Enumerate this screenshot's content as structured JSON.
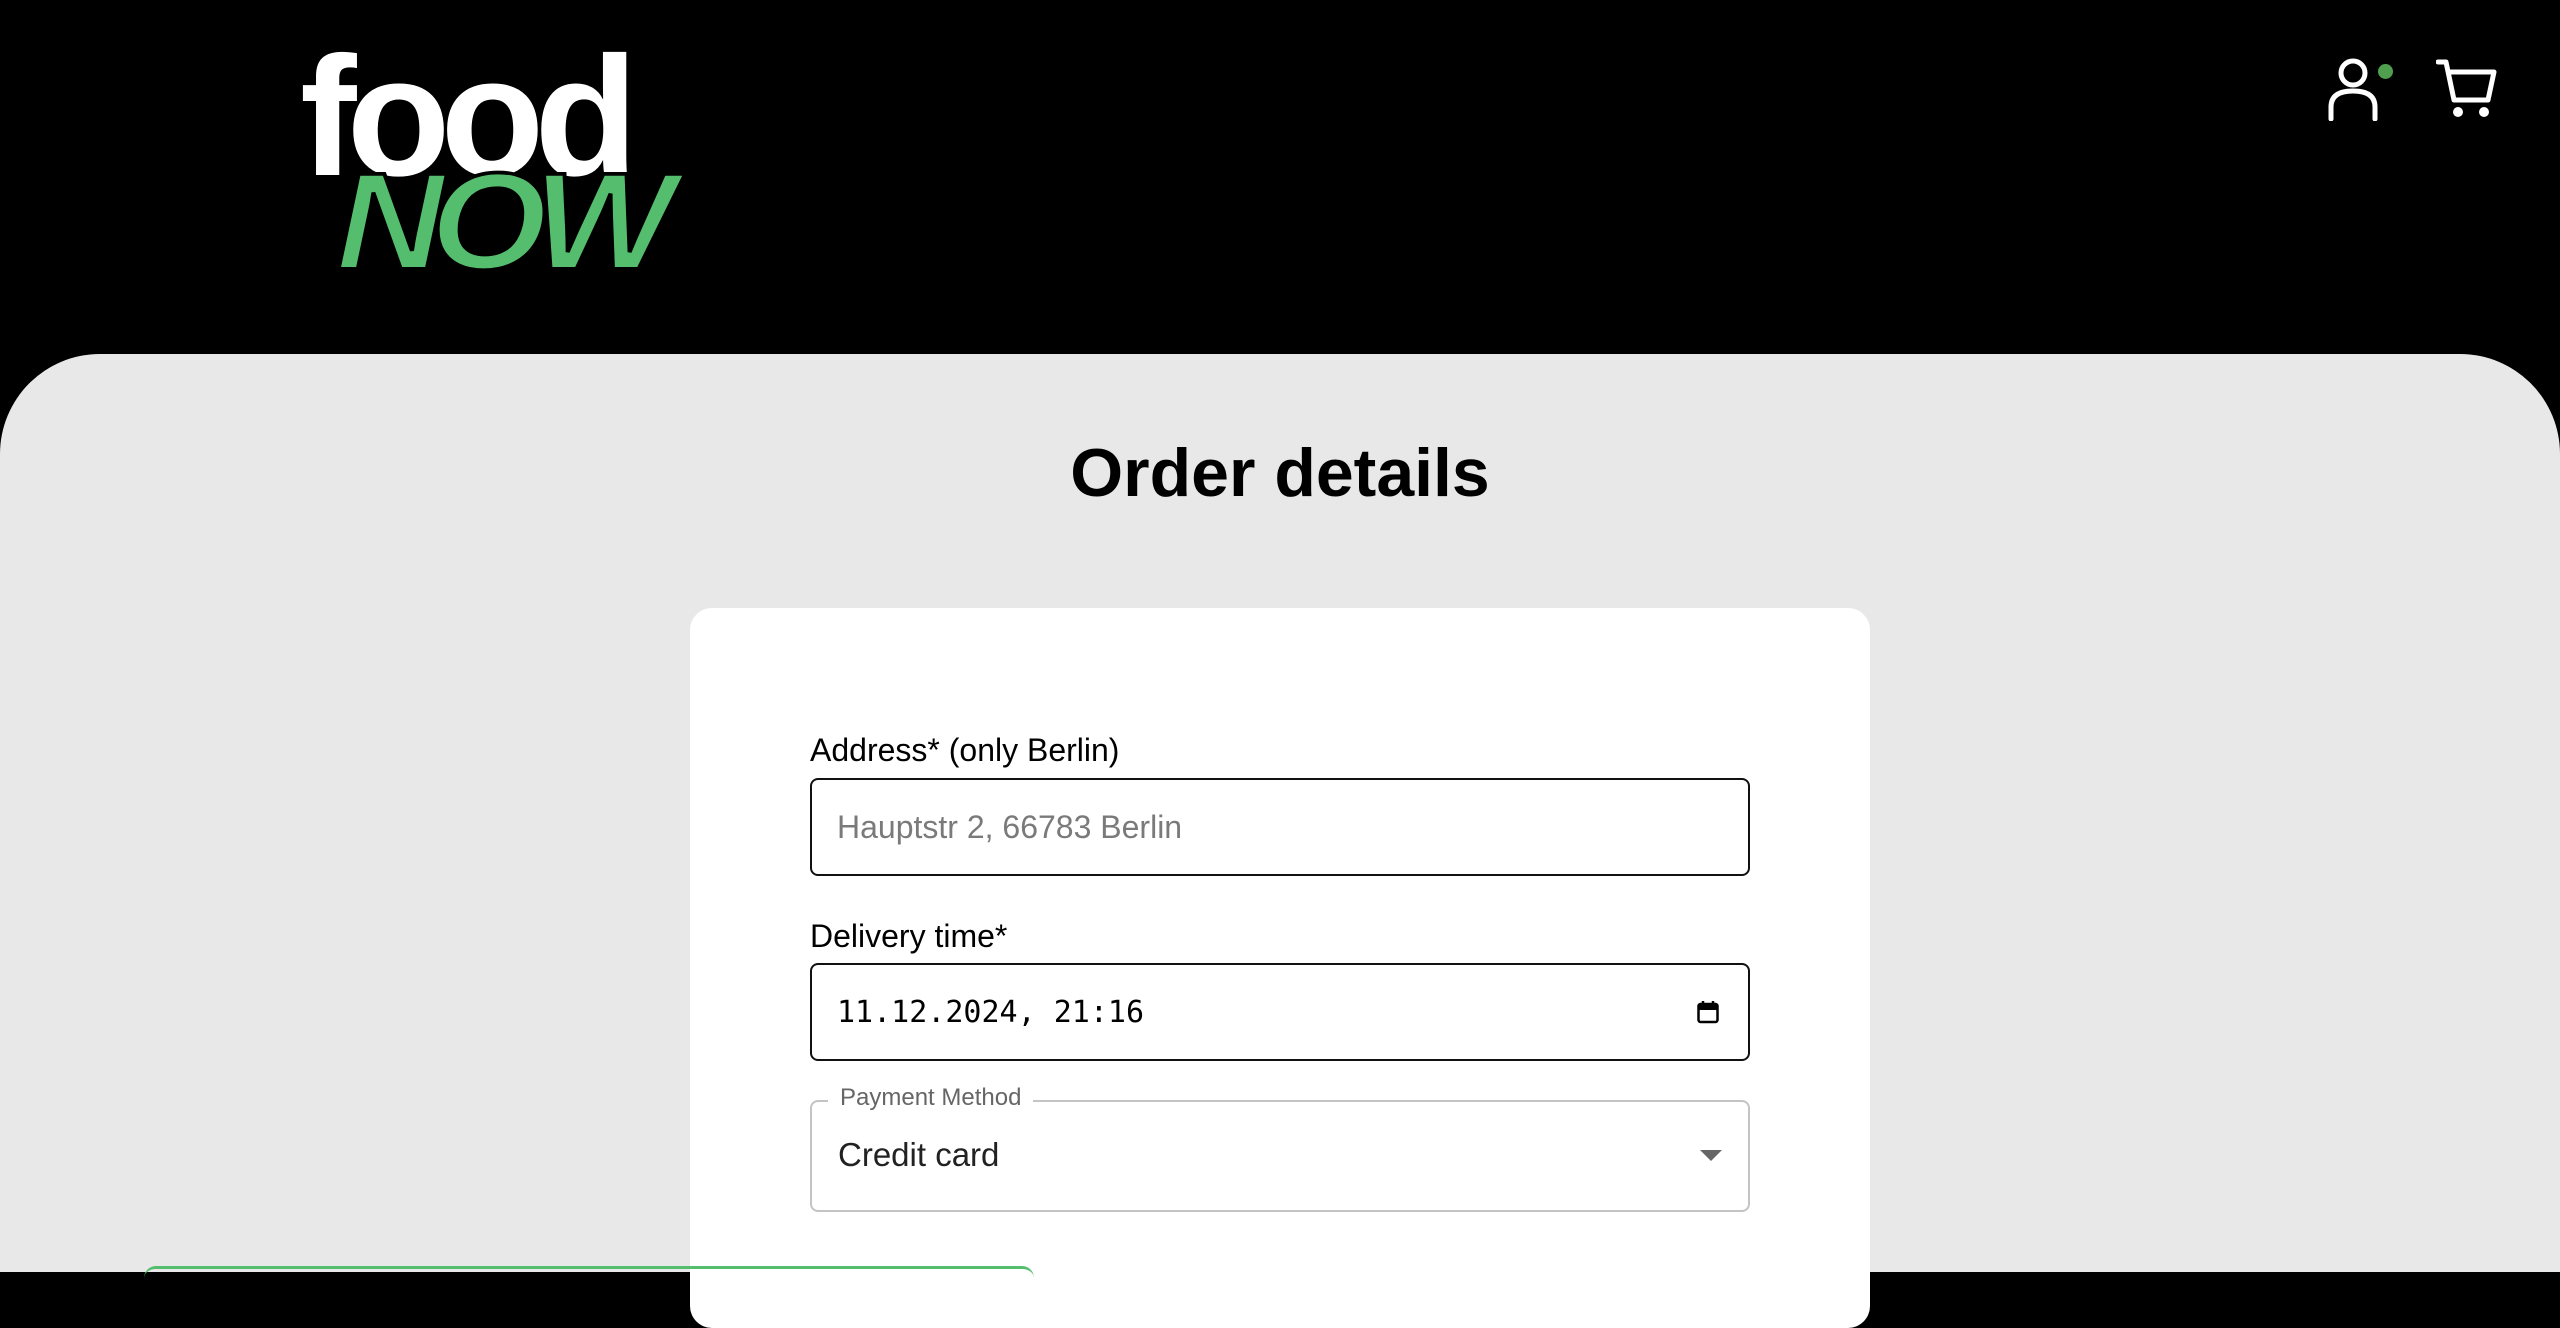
{
  "brand": {
    "logo_top": "food",
    "logo_bottom": "NOW",
    "accent_color": "#55bd6e"
  },
  "header": {
    "user_icon": "user-icon",
    "cart_icon": "cart-icon",
    "user_status_color": "#4f9f4f"
  },
  "page": {
    "title": "Order details"
  },
  "form": {
    "address": {
      "label": "Address* (only Berlin)",
      "placeholder": "Hauptstr 2, 66783 Berlin",
      "value": ""
    },
    "delivery_time": {
      "label": "Delivery time*",
      "value": "11.12.2024, 21:16",
      "icon": "calendar-icon"
    },
    "payment_method": {
      "legend": "Payment Method",
      "selected": "Credit card",
      "icon": "dropdown-arrow-icon"
    }
  }
}
